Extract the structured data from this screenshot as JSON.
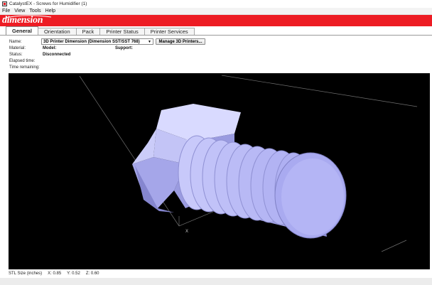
{
  "window": {
    "title": "CatalystEX - Screws for Humidifier (1)",
    "icon": "catalystex-app-icon"
  },
  "menu": [
    "File",
    "View",
    "Tools",
    "Help"
  ],
  "brand": {
    "logo_text": "dimension",
    "bar_color": "#ed1c24"
  },
  "tabs": [
    {
      "label": "General",
      "active": true
    },
    {
      "label": "Orientation",
      "active": false
    },
    {
      "label": "Pack",
      "active": false
    },
    {
      "label": "Printer Status",
      "active": false
    },
    {
      "label": "Printer Services",
      "active": false
    }
  ],
  "printer": {
    "name_label": "Name:",
    "name_value": "3D Printer Dimension  (Dimension SST/SST 768)",
    "manage_button": "Manage 3D Printers...",
    "material_label": "Material:",
    "model_label": "Model:",
    "support_label": "Support:",
    "status_label": "Status:",
    "status_value": "Disconnected",
    "elapsed_label": "Elapsed time:",
    "remaining_label": "Time remaining:"
  },
  "viewport": {
    "axis_label": "X",
    "background": "#000000",
    "model_color": "#b7b8f6"
  },
  "status_bar": {
    "size_label": "STL Size (inches)",
    "x": "X: 0.85",
    "y": "Y: 0.52",
    "z": "Z: 0.60"
  }
}
